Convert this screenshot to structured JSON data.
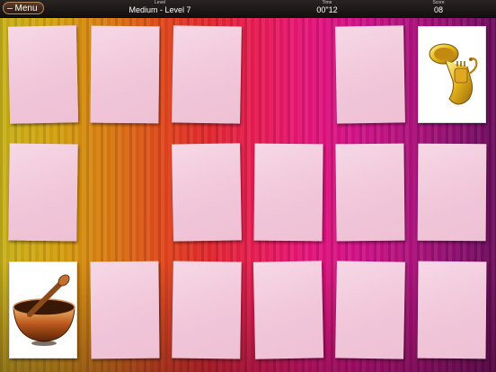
{
  "header": {
    "menu_label": "Menu",
    "level_label": "Level",
    "level_value": "Medium - Level 7",
    "time_label": "Time",
    "time_value": "00\"12",
    "score_label": "Score",
    "score_value": "08"
  },
  "board": {
    "rows": 3,
    "cols": 6,
    "cards": [
      {
        "row": 0,
        "col": 0,
        "state": "face-down"
      },
      {
        "row": 0,
        "col": 1,
        "state": "face-down"
      },
      {
        "row": 0,
        "col": 2,
        "state": "face-down"
      },
      {
        "row": 0,
        "col": 3,
        "state": "matched-empty"
      },
      {
        "row": 0,
        "col": 4,
        "state": "face-down"
      },
      {
        "row": 0,
        "col": 5,
        "state": "face-up",
        "icon": "tuba-icon"
      },
      {
        "row": 1,
        "col": 0,
        "state": "face-down"
      },
      {
        "row": 1,
        "col": 1,
        "state": "matched-empty"
      },
      {
        "row": 1,
        "col": 2,
        "state": "face-down"
      },
      {
        "row": 1,
        "col": 3,
        "state": "face-down"
      },
      {
        "row": 1,
        "col": 4,
        "state": "face-down"
      },
      {
        "row": 1,
        "col": 5,
        "state": "face-down"
      },
      {
        "row": 2,
        "col": 0,
        "state": "face-up",
        "icon": "singing-bowl-icon"
      },
      {
        "row": 2,
        "col": 1,
        "state": "face-down"
      },
      {
        "row": 2,
        "col": 2,
        "state": "face-down"
      },
      {
        "row": 2,
        "col": 3,
        "state": "face-down"
      },
      {
        "row": 2,
        "col": 4,
        "state": "face-down"
      },
      {
        "row": 2,
        "col": 5,
        "state": "face-down"
      }
    ]
  },
  "colors": {
    "card_back": "#f1c6d9",
    "topbar": "#1c1816",
    "menu_border": "#b88a5a"
  }
}
